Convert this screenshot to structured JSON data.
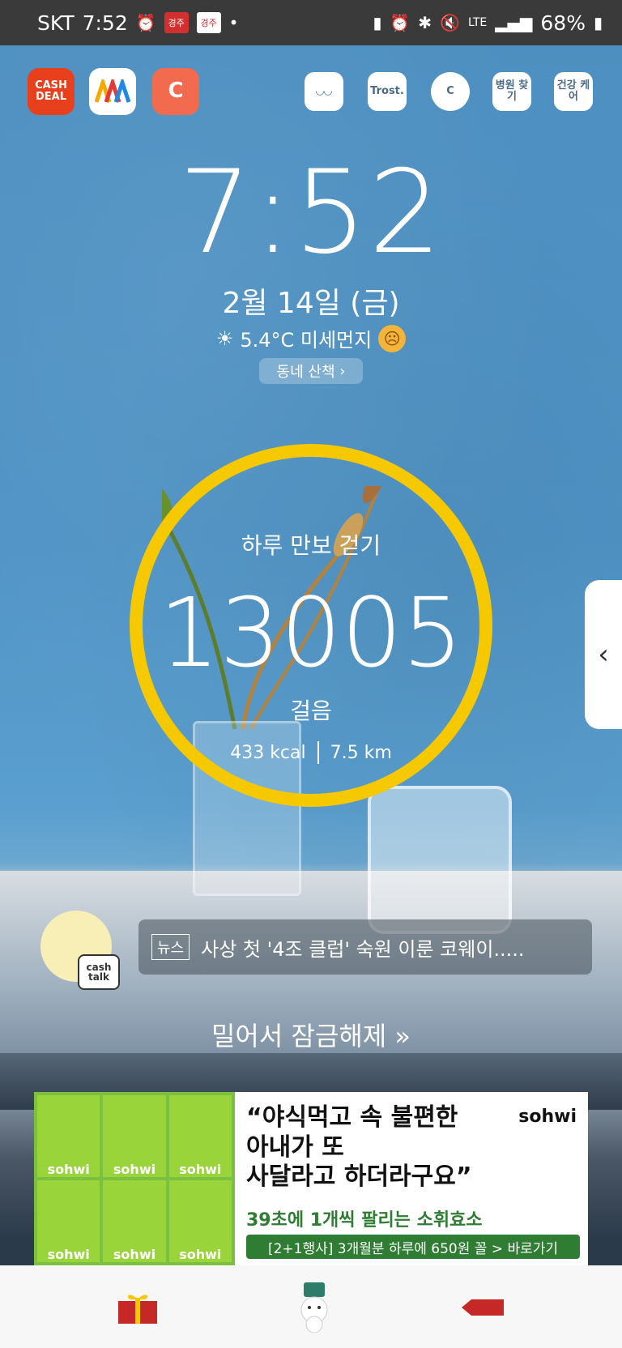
{
  "status": {
    "carrier": "SKT",
    "time": "7:52",
    "news1": "경주",
    "news2": "경주",
    "battery": "68%",
    "net": "LTE"
  },
  "apps_left": [
    {
      "label": "CASH DEAL"
    },
    {
      "label": ""
    },
    {
      "label": "C"
    }
  ],
  "apps_right": [
    {
      "label": ""
    },
    {
      "label": "Trost."
    },
    {
      "label": "C"
    },
    {
      "label": "병원 찾기"
    },
    {
      "label": "건강 케어"
    }
  ],
  "lock": {
    "time": "7:52",
    "date": "2월 14일 (금)",
    "weather": "5.4°C 미세먼지",
    "walk": "동네 산책"
  },
  "steps": {
    "title": "하루 만보 걷기",
    "count": "13005",
    "unit": "걸음",
    "kcal": "433 kcal",
    "km": "7.5 km"
  },
  "news": {
    "tag": "뉴스",
    "text": "사상 첫 '4조 클럽' 숙원 이룬 코웨이.....",
    "avatar": "cash talk"
  },
  "unlock": "밀어서 잠금해제",
  "ad": {
    "line1": "“야식먹고 속 불편한",
    "line2": "아내가 또",
    "line3": "사달라고 하더라구요”",
    "brand": "sohwi",
    "sub": "39초에 1개씩 팔리는 소휘효소",
    "cta": "[2+1행사] 3개월분 하루에 650원 꼴  > 바로가기",
    "box": "sohwi"
  },
  "colors": {
    "ring": "#f5c800",
    "wall": "#4f93c5",
    "cta": "#2e7d32"
  }
}
